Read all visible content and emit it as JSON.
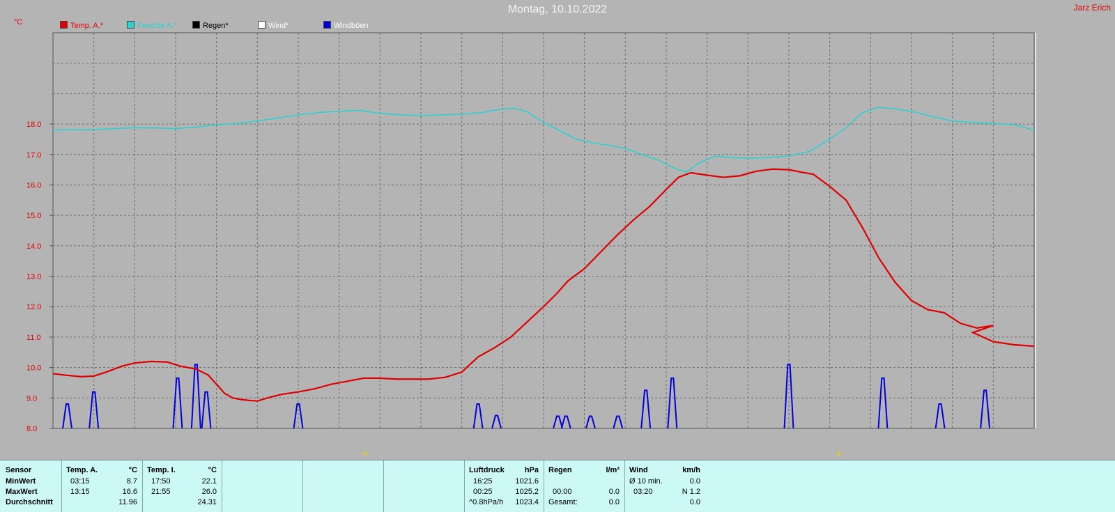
{
  "header": {
    "title": "Montag, 10.10.2022",
    "credit": "Jarz Erich",
    "unit": "°C"
  },
  "colors": {
    "background": "#b4b4b4",
    "grid": "#6e6e6e",
    "temp": "#e00000",
    "humidity": "#28d2d2",
    "gusts": "#0000dc",
    "wind": "#ffffff",
    "rain": "#000000",
    "table_bg": "#ccf8f6"
  },
  "legend": [
    {
      "label": "Temp. A.*",
      "color": "#e00000"
    },
    {
      "label": "Feuchte A.*",
      "color": "#28d2d2"
    },
    {
      "label": "Regen*",
      "color": "#000000"
    },
    {
      "label": "Wind*",
      "color": "#ffffff"
    },
    {
      "label": "Windböen",
      "color": "#0000dc"
    }
  ],
  "chart_data": {
    "type": "line",
    "ylim": [
      8.0,
      21.0
    ],
    "yticks": [
      "8.0",
      "9.0",
      "10.0",
      "11.0",
      "12.0",
      "13.0",
      "14.0",
      "15.0",
      "16.0",
      "17.0",
      "18.0"
    ],
    "xlim": [
      0,
      24
    ],
    "grid": true,
    "legend_position": "top-left",
    "series": [
      {
        "name": "Temp. A.*",
        "color": "#e00000",
        "x": [
          0,
          0.3,
          0.7,
          1.0,
          1.3,
          1.7,
          2.0,
          2.4,
          2.8,
          3.1,
          3.5,
          3.8,
          4.0,
          4.2,
          4.4,
          4.6,
          4.8,
          5.0,
          5.3,
          5.6,
          6.0,
          6.4,
          6.8,
          7.2,
          7.6,
          8.0,
          8.4,
          8.8,
          9.2,
          9.6,
          10.0,
          10.4,
          10.8,
          11.2,
          11.6,
          12.0,
          12.3,
          12.6,
          13.0,
          13.4,
          13.8,
          14.2,
          14.6,
          15.0,
          15.3,
          15.6,
          16.0,
          16.4,
          16.8,
          17.2,
          17.6,
          18.0,
          18.3,
          18.6,
          19.0,
          19.4,
          19.8,
          20.2,
          20.6,
          21.0,
          21.4,
          21.8,
          22.2,
          22.6,
          23.0,
          23.4,
          23.8,
          24.0
        ],
        "values": [
          9.8,
          9.75,
          9.7,
          9.72,
          9.85,
          10.05,
          10.15,
          10.2,
          10.18,
          10.05,
          9.95,
          9.75,
          9.45,
          9.15,
          9.0,
          8.95,
          8.92,
          8.9,
          9.02,
          9.12,
          9.2,
          9.3,
          9.45,
          9.55,
          9.65,
          9.65,
          9.62,
          9.62,
          9.62,
          9.68,
          9.85,
          10.35,
          10.65,
          11.0,
          11.5,
          12.0,
          12.4,
          12.85,
          13.25,
          13.8,
          14.35,
          14.85,
          15.3,
          15.85,
          16.25,
          16.4,
          16.32,
          16.25,
          16.3,
          16.45,
          16.52,
          16.5,
          16.42,
          16.35,
          15.95,
          15.5,
          14.6,
          13.6,
          12.8,
          12.2,
          11.9,
          11.8,
          11.45,
          11.3,
          11.38,
          11.55,
          11.45,
          11.25
        ],
        "x_tail": [
          22.5,
          23.0,
          23.5,
          24.0
        ],
        "values_tail": [
          11.15,
          10.85,
          10.75,
          10.7
        ]
      },
      {
        "name": "Feuchte A.*",
        "color": "#28d2d2",
        "x": [
          0,
          0.5,
          1.0,
          1.5,
          2.0,
          2.5,
          3.0,
          3.5,
          4.0,
          4.5,
          5.0,
          5.5,
          6.0,
          6.5,
          7.0,
          7.5,
          8.0,
          8.5,
          9.0,
          9.5,
          10.0,
          10.5,
          11.0,
          11.3,
          11.6,
          12.0,
          12.4,
          12.8,
          13.2,
          13.6,
          14.0,
          14.4,
          14.8,
          15.2,
          15.5,
          15.8,
          16.2,
          16.6,
          17.0,
          17.5,
          18.0,
          18.5,
          19.0,
          19.4,
          19.8,
          20.2,
          20.6,
          21.0,
          21.5,
          22.0,
          22.5,
          23.0,
          23.5,
          24.0
        ],
        "values": [
          17.8,
          17.82,
          17.82,
          17.85,
          17.88,
          17.87,
          17.85,
          17.9,
          17.98,
          18.02,
          18.1,
          18.2,
          18.3,
          18.38,
          18.42,
          18.45,
          18.35,
          18.3,
          18.28,
          18.3,
          18.32,
          18.38,
          18.5,
          18.52,
          18.4,
          18.05,
          17.78,
          17.5,
          17.38,
          17.3,
          17.2,
          17.0,
          16.82,
          16.55,
          16.42,
          16.72,
          16.95,
          16.9,
          16.88,
          16.9,
          16.95,
          17.1,
          17.5,
          17.88,
          18.38,
          18.55,
          18.5,
          18.42,
          18.25,
          18.1,
          18.05,
          18.02,
          17.98,
          17.8
        ]
      },
      {
        "name": "Windböen",
        "color": "#0000dc",
        "spikes": [
          [
            0.35,
            8.8
          ],
          [
            1.0,
            9.2
          ],
          [
            3.05,
            9.65
          ],
          [
            3.5,
            10.1
          ],
          [
            3.75,
            9.2
          ],
          [
            6.0,
            8.8
          ],
          [
            10.4,
            8.8
          ],
          [
            10.85,
            8.42
          ],
          [
            12.35,
            8.4
          ],
          [
            12.55,
            8.4
          ],
          [
            13.15,
            8.4
          ],
          [
            13.82,
            8.4
          ],
          [
            14.5,
            9.25
          ],
          [
            15.15,
            9.65
          ],
          [
            18.0,
            10.1
          ],
          [
            20.3,
            9.65
          ],
          [
            21.7,
            8.8
          ],
          [
            22.8,
            9.25
          ]
        ],
        "spike_width": 0.22
      }
    ]
  },
  "sun_icons": [
    {
      "label": "☀"
    },
    {
      "label": "☀"
    }
  ],
  "table": {
    "sensor": {
      "h": "Sensor",
      "min": "MinWert",
      "max": "MaxWert",
      "avg": "Durchschnitt"
    },
    "temp_a": {
      "h": "Temp. A.",
      "unit": "°C",
      "min_t": "03:15",
      "min_v": "8.7",
      "max_t": "13:15",
      "max_v": "16.6",
      "avg_v": "11.96"
    },
    "temp_i": {
      "h": "Temp. I.",
      "unit": "°C",
      "min_t": "17:50",
      "min_v": "22.1",
      "max_t": "21:55",
      "max_v": "26.0",
      "avg_v": "24.31"
    },
    "pressure": {
      "h": "Luftdruck",
      "unit": "hPa",
      "min_t": "16:25",
      "min_v": "1021.6",
      "max_t": "00:25",
      "max_v": "1025.2",
      "avg_l": "^0.8hPa/h",
      "avg_v": "1023.4"
    },
    "rain": {
      "h": "Regen",
      "unit": "l/m²",
      "max_t": "00:00",
      "max_v": "0.0",
      "avg_l": "Gesamt:",
      "avg_v": "0.0"
    },
    "wind": {
      "h": "Wind",
      "unit": "km/h",
      "min_l": "Ø 10 min.",
      "min_v": "0.0",
      "max_t": "03:20",
      "max_v": "N 1.2",
      "avg_v": "0.0"
    }
  }
}
